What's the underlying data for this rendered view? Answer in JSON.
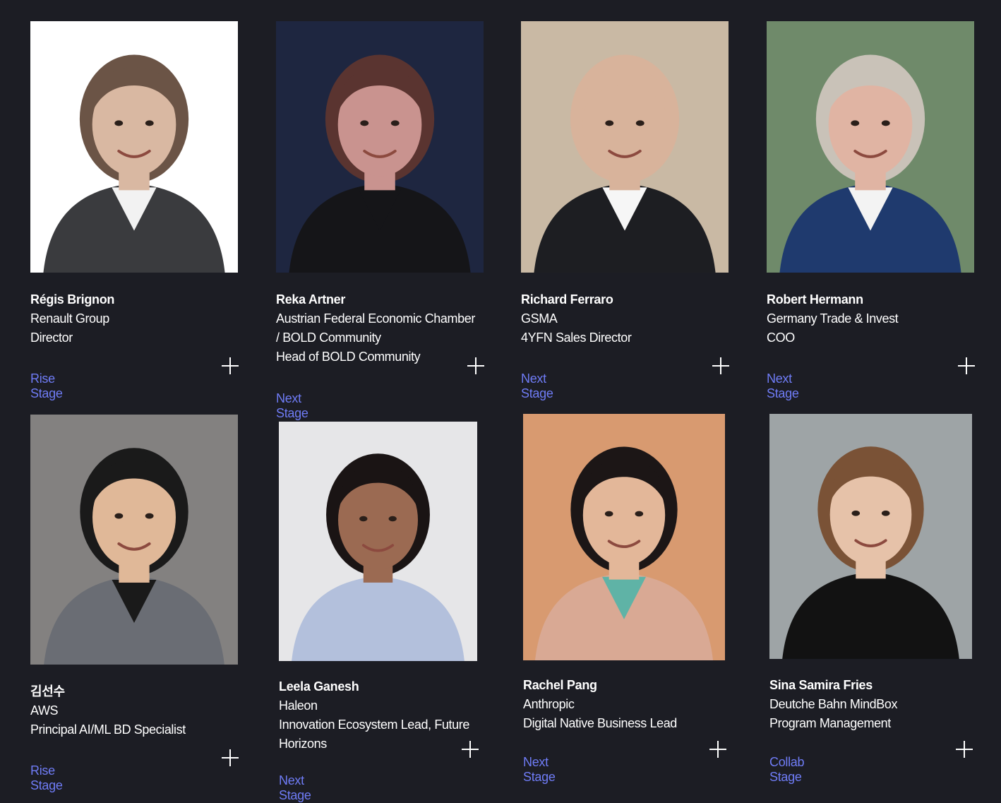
{
  "speakers": [
    {
      "name": "Régis Brignon",
      "company": "Renault Group",
      "title_lines": [
        "Director"
      ],
      "stage": "Rise Stage",
      "photo": {
        "bg": "#ffffff",
        "skin": "#d9b8a2",
        "hair": "#6b5446",
        "suit": "#3a3b3e",
        "shirt": "#f2f2f2"
      }
    },
    {
      "name": "Reka Artner",
      "company": "Austrian Federal Economic Chamber",
      "title_lines": [
        "/ BOLD Community",
        "Head of BOLD Community"
      ],
      "stage": "Next Stage",
      "photo": {
        "bg": "#1e2640",
        "skin": "#c9938f",
        "hair": "#5a3430",
        "suit": "#151518",
        "shirt": "#151518"
      }
    },
    {
      "name": "Richard Ferraro",
      "company": "GSMA",
      "title_lines": [
        "4YFN Sales Director"
      ],
      "stage": "Next Stage",
      "photo": {
        "bg": "#c9b9a4",
        "skin": "#d8b39b",
        "hair": "#d8b39b",
        "suit": "#1d1e22",
        "shirt": "#f6f6f6"
      }
    },
    {
      "name": "Robert Hermann",
      "company": "Germany Trade & Invest",
      "title_lines": [
        "COO"
      ],
      "stage": "Next Stage",
      "photo": {
        "bg": "#6f8a6a",
        "skin": "#e0b4a3",
        "hair": "#c9c2b8",
        "suit": "#1f3a6e",
        "shirt": "#f3f3f3"
      }
    },
    {
      "name": "김선수",
      "company": "AWS",
      "title_lines": [
        "Principal AI/ML BD Specialist"
      ],
      "stage": "Rise Stage",
      "photo": {
        "bg": "#838180",
        "skin": "#e0b898",
        "hair": "#1a1a1a",
        "suit": "#6a6d74",
        "shirt": "#1a1a1a"
      }
    },
    {
      "name": "Leela Ganesh",
      "company": "Haleon",
      "title_lines": [
        "Innovation Ecosystem Lead, Future",
        "Horizons"
      ],
      "stage": "Next Stage",
      "photo": {
        "bg": "#e6e6e8",
        "skin": "#9b6a52",
        "hair": "#1a1414",
        "suit": "#b3c0dc",
        "shirt": "#b3c0dc"
      }
    },
    {
      "name": "Rachel Pang",
      "company": "Anthropic",
      "title_lines": [
        "Digital Native Business Lead"
      ],
      "stage": "Next Stage",
      "photo": {
        "bg": "#d89a70",
        "skin": "#e3b799",
        "hair": "#1c1616",
        "suit": "#d9a994",
        "shirt": "#5fb3a6"
      }
    },
    {
      "name": "Sina Samira Fries",
      "company": "Deutche Bahn MindBox",
      "title_lines": [
        "Program Management"
      ],
      "stage": "Collab Stage",
      "photo": {
        "bg": "#9ea4a6",
        "skin": "#e6c2a9",
        "hair": "#7a5236",
        "suit": "#121212",
        "shirt": "#121212"
      }
    }
  ]
}
